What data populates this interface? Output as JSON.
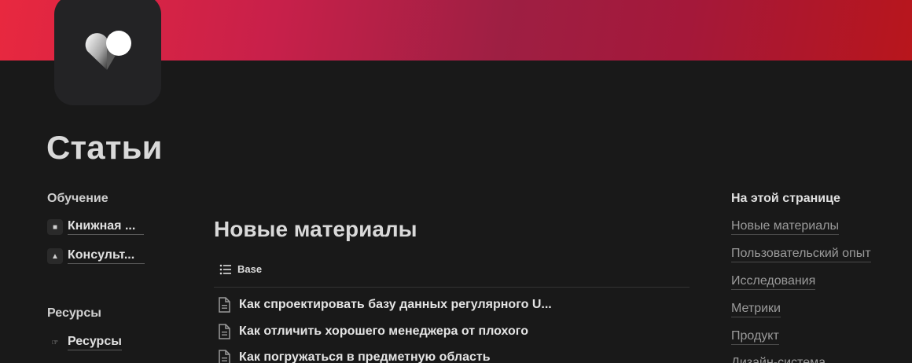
{
  "cover": {
    "gradient_colors": [
      "#e8283f",
      "#9e1f43",
      "#b8161c"
    ]
  },
  "page": {
    "icon": "heart-logo-icon",
    "title": "Статьи"
  },
  "left_nav": {
    "sections": [
      {
        "title": "Обучение",
        "items": [
          {
            "icon": "book-icon",
            "label": "Книжная ..."
          },
          {
            "icon": "graduation-cap-icon",
            "label": "Консульт..."
          }
        ]
      },
      {
        "title": "Ресурсы",
        "items": [
          {
            "icon": "hand-pointer-icon",
            "label": "Ресурсы"
          }
        ]
      }
    ]
  },
  "main": {
    "heading": "Новые материалы",
    "view": {
      "icon": "list-icon",
      "label": "Base"
    },
    "rows": [
      {
        "icon": "document-icon",
        "title": "Как спроектировать базу данных регулярного U..."
      },
      {
        "icon": "document-icon",
        "title": "Как отличить хорошего менеджера от плохого"
      },
      {
        "icon": "document-icon",
        "title": "Как погружаться в предметную область"
      }
    ]
  },
  "toc": {
    "title": "На этой странице",
    "links": [
      "Новые материалы",
      "Пользовательский опыт",
      "Исследования",
      "Метрики",
      "Продукт",
      "Дизайн-система"
    ]
  }
}
